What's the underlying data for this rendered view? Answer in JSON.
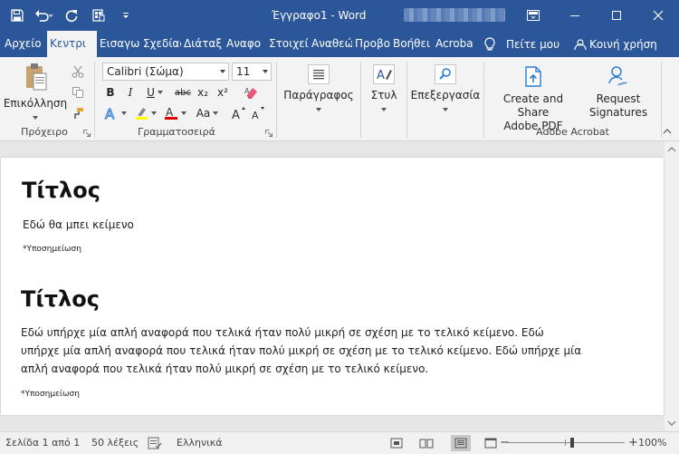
{
  "window": {
    "title": "Έγγραφο1",
    "title_sep": " - ",
    "app_name": "Word"
  },
  "tabs": {
    "items": [
      "Αρχείο",
      "Κεντρι",
      "Εισαγω",
      "Σχεδίας",
      "Διάταξ",
      "Αναφο",
      "Στοιχεί",
      "Αναθεώ",
      "Προβο",
      "Βοήθει",
      "Acroba"
    ],
    "active_index": 1,
    "tell_me": "Πείτε μου",
    "share": "Κοινή χρήση"
  },
  "ribbon": {
    "clipboard": {
      "paste_label": "Επικόλληση",
      "group_label": "Πρόχειρο"
    },
    "font": {
      "font_name": "Calibri (Σώμα)",
      "font_size": "11",
      "bold": "B",
      "italic": "I",
      "underline": "U",
      "strike": "abc",
      "subscript": "x₂",
      "superscript": "x²",
      "case": "Aa",
      "group_label": "Γραμματοσειρά"
    },
    "paragraph": {
      "label": "Παράγραφος"
    },
    "styles": {
      "label": "Στυλ"
    },
    "editing": {
      "label": "Επεξεργασία"
    },
    "acrobat": {
      "create_label_1": "Create and Share",
      "create_label_2": "Adobe PDF",
      "request_label_1": "Request",
      "request_label_2": "Signatures",
      "group_label": "Adobe Acrobat"
    }
  },
  "document": {
    "heading1": "Τίτλος",
    "text1": "Εδώ θα μπει κείμενο",
    "footnote1": "*Υποσημείωση",
    "heading2": "Τίτλος",
    "text2_line1": "Εδώ υπήρχε μία απλή αναφορά που τελικά ήταν πολύ μικρή σε σχέση με το τελικό κείμενο. Εδώ",
    "text2_line2": "υπήρχε μία απλή αναφορά που τελικά ήταν πολύ μικρή σε σχέση με το τελικό κείμενο. Εδώ υπήρχε μία",
    "text2_line3": "απλή αναφορά που τελικά ήταν πολύ μικρή σε σχέση με το τελικό κείμενο.",
    "footnote2": "*Υποσημείωση"
  },
  "status": {
    "page": "Σελίδα 1 από 1",
    "words": "50 λέξεις",
    "language": "Ελληνικά",
    "zoom_minus": "−",
    "zoom_plus": "+",
    "zoom": "100%"
  },
  "colors": {
    "title_bar": "#2b579a",
    "ribbon_bg": "#f3f3f3",
    "highlight": "#ffff00",
    "font_color": "#e00000"
  }
}
